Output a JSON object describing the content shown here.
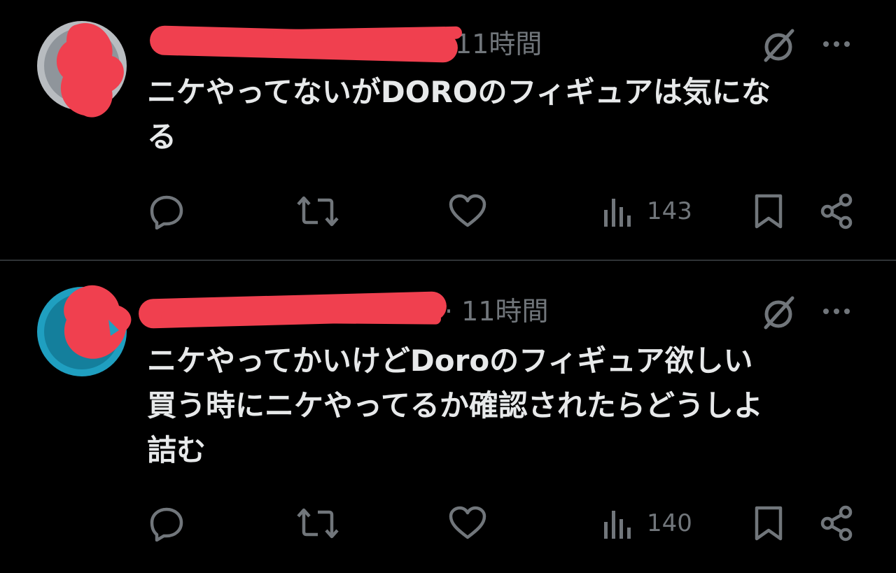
{
  "posts": [
    {
      "meta_time": "11時間",
      "text_lines": [
        "ニケやってないがDOROのフィギュアは気にな",
        "る"
      ],
      "views": "143",
      "icons": {
        "grok": "grok-icon",
        "more": "more-icon",
        "reply": "reply-icon",
        "repost": "repost-icon",
        "like": "heart-icon",
        "views": "views-icon",
        "bookmark": "bookmark-icon",
        "share": "share-icon"
      }
    },
    {
      "meta_time": "· 11時間",
      "text_lines": [
        "ニケやってかいけどDoroのフィギュア欲しい",
        "買う時にニケやってるか確認されたらどうしよ",
        "詰む"
      ],
      "views": "140",
      "icons": {
        "grok": "grok-icon",
        "more": "more-icon",
        "reply": "reply-icon",
        "repost": "repost-icon",
        "like": "heart-icon",
        "views": "views-icon",
        "bookmark": "bookmark-icon",
        "share": "share-icon"
      }
    }
  ],
  "colors": {
    "background": "#000000",
    "text": "#e7e9ea",
    "secondary": "#71767b",
    "redaction": "#f0404f",
    "divider": "#2f3336"
  }
}
